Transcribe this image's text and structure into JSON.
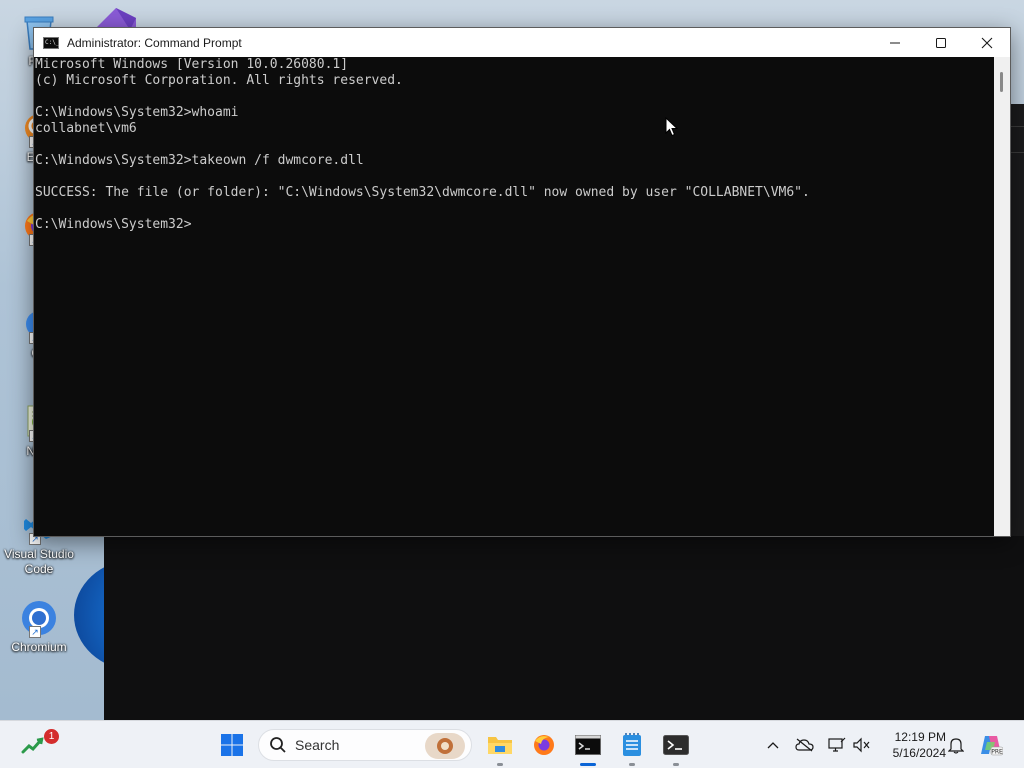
{
  "desktop": {
    "icons": [
      {
        "label": "Rec",
        "name": "recycle-bin"
      },
      {
        "label": "Ever",
        "name": "everything"
      },
      {
        "label": "Fi",
        "name": "firefox"
      },
      {
        "label": "Git",
        "name": "git"
      },
      {
        "label": "Note",
        "name": "notepad-plus-plus"
      },
      {
        "label": "Visual Studio Code",
        "name": "visual-studio-code"
      },
      {
        "label": "Chromium",
        "name": "chromium"
      }
    ]
  },
  "window": {
    "title": "Administrator: Command Prompt",
    "app_icon_glyph": "C:\\_",
    "icons": {
      "minimize": "minimize-icon",
      "maximize": "maximize-icon",
      "close": "close-icon"
    }
  },
  "console": {
    "lines": [
      "Microsoft Windows [Version 10.0.26080.1]",
      "(c) Microsoft Corporation. All rights reserved.",
      "",
      "C:\\Windows\\System32>whoami",
      "collabnet\\vm6",
      "",
      "C:\\Windows\\System32>takeown /f dwmcore.dll",
      "",
      "SUCCESS: The file (or folder): \"C:\\Windows\\System32\\dwmcore.dll\" now owned by user \"COLLABNET\\VM6\".",
      "",
      "C:\\Windows\\System32>"
    ]
  },
  "taskbar": {
    "widgets_badge": "1",
    "search_label": "Search",
    "pinned": [
      {
        "name": "start",
        "icon": "windows-logo-icon"
      },
      {
        "name": "file-explorer",
        "icon": "folder-icon"
      },
      {
        "name": "firefox",
        "icon": "firefox-icon"
      },
      {
        "name": "command-prompt",
        "icon": "terminal-icon",
        "active": true
      },
      {
        "name": "notepad",
        "icon": "notepad-icon"
      },
      {
        "name": "terminal",
        "icon": "terminal-icon"
      }
    ],
    "clock": {
      "time": "12:19 PM",
      "date": "5/16/2024"
    }
  },
  "colors": {
    "console_bg": "#0c0c0c",
    "console_fg": "#cccccc",
    "taskbar_bg": "#eef1f6",
    "accent": "#0a64d6"
  }
}
